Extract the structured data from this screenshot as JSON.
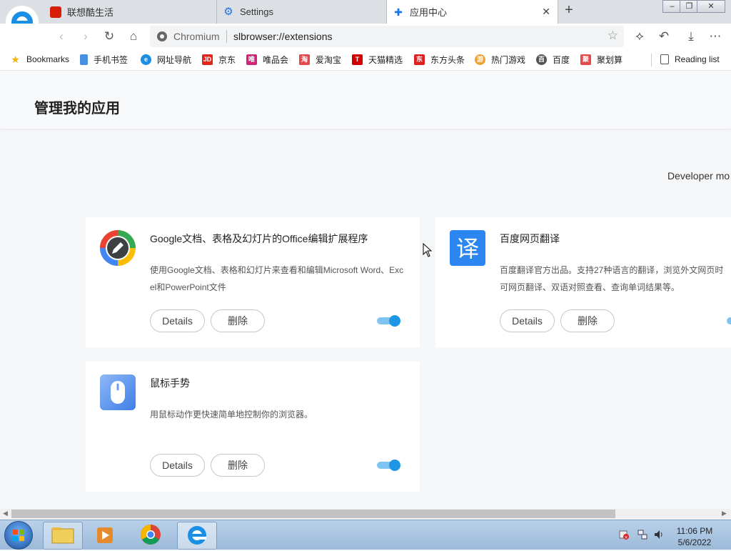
{
  "browser": {
    "tabs": [
      {
        "title": "联想酷生活",
        "favicon": "lenovo-life-icon",
        "active": false
      },
      {
        "title": "Settings",
        "favicon": "gear-icon",
        "active": false
      },
      {
        "title": "应用中心",
        "favicon": "puzzle-icon",
        "active": true
      }
    ],
    "window_controls": [
      "minimize",
      "maximize",
      "close"
    ]
  },
  "toolbar": {
    "site_label": "Chromium",
    "url": "slbrowser://extensions",
    "icons": [
      "back-icon",
      "forward-icon",
      "reload-icon",
      "home-icon",
      "extensions-icon",
      "undo-icon",
      "download-icon",
      "more-icon"
    ]
  },
  "bookmarks": [
    {
      "label": "Bookmarks",
      "color": "#f4b400",
      "glyph": "★"
    },
    {
      "label": "手机书签",
      "color": "#4a90e2",
      "glyph": ""
    },
    {
      "label": "网址导航",
      "color": "#1a8fe3",
      "glyph": "e"
    },
    {
      "label": "京东",
      "color": "#e1251b",
      "glyph": "JD"
    },
    {
      "label": "唯品会",
      "color": "#d4237a",
      "glyph": "唯"
    },
    {
      "label": "爱淘宝",
      "color": "#e5484d",
      "glyph": "淘"
    },
    {
      "label": "天猫精选",
      "color": "#d40000",
      "glyph": "T"
    },
    {
      "label": "东方头条",
      "color": "#e02020",
      "glyph": "东"
    },
    {
      "label": "热门游戏",
      "color": "#f0a030",
      "glyph": "游"
    },
    {
      "label": "百度",
      "color": "#555555",
      "glyph": "百"
    },
    {
      "label": "聚划算",
      "color": "#e5484d",
      "glyph": "聚"
    }
  ],
  "reading_list": "Reading list",
  "page": {
    "title": "管理我的应用",
    "developer_mode": "Developer mo"
  },
  "extensions": [
    {
      "name": "Google文档、表格及幻灯片的Office编辑扩展程序",
      "description": "使用Google文档、表格和幻灯片来查看和编辑Microsoft Word、Excel和PowerPoint文件",
      "details_label": "Details",
      "remove_label": "删除",
      "enabled": true,
      "icon": "google-docs-pencil-icon"
    },
    {
      "name": "百度网页翻译",
      "description": "百度翻译官方出品。支持27种语言的翻译，浏览外文网页时可网页翻译、双语对照查看、查询单词结果等。",
      "details_label": "Details",
      "remove_label": "删除",
      "enabled": true,
      "icon": "translate-icon"
    },
    {
      "name": "鼠标手势",
      "description": "用鼠标动作更快速简单地控制你的浏览器。",
      "details_label": "Details",
      "remove_label": "删除",
      "enabled": true,
      "icon": "mouse-icon"
    }
  ],
  "taskbar": {
    "time": "11:06 PM",
    "date": "5/6/2022"
  }
}
